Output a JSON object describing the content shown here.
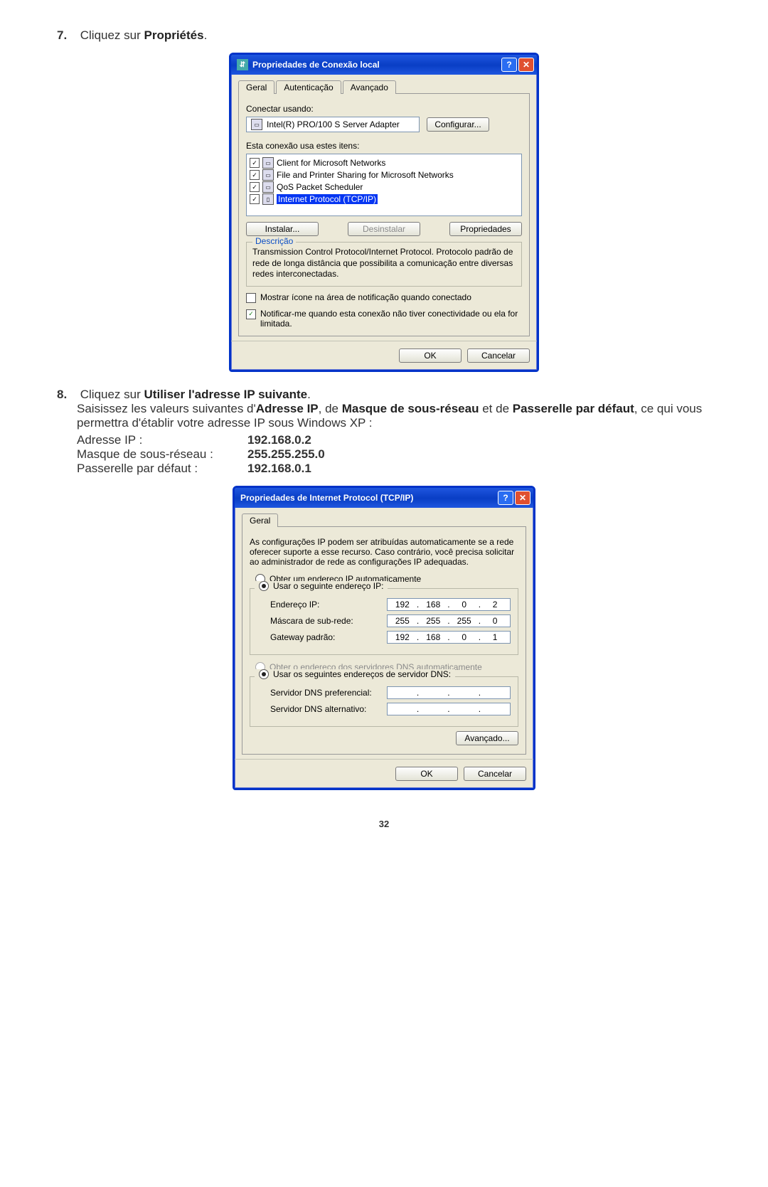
{
  "step7": {
    "num": "7.",
    "pre": "Cliquez sur ",
    "bold": "Propriétés",
    "post": "."
  },
  "win1": {
    "title": "Propriedades de Conexão local",
    "tabs": {
      "geral": "Geral",
      "aut": "Autenticação",
      "av": "Avançado"
    },
    "connect_label": "Conectar usando:",
    "adapter": "Intel(R) PRO/100 S Server Adapter",
    "configurar_btn": "Configurar...",
    "items_label": "Esta conexão usa estes itens:",
    "items": [
      "Client for Microsoft Networks",
      "File and Printer Sharing for Microsoft Networks",
      "QoS Packet Scheduler",
      "Internet Protocol (TCP/IP)"
    ],
    "instalar_btn": "Instalar...",
    "desinstalar_btn": "Desinstalar",
    "propriedades_btn": "Propriedades",
    "desc_legend": "Descrição",
    "desc_text": "Transmission Control Protocol/Internet Protocol. Protocolo padrão de rede de longa distância que possibilita a comunicação entre diversas redes interconectadas.",
    "chk1": "Mostrar ícone na área de notificação quando conectado",
    "chk2": "Notificar-me quando esta conexão não tiver conectividade ou ela for limitada.",
    "ok": "OK",
    "cancel": "Cancelar"
  },
  "step8": {
    "num": "8.",
    "line1_pre": "Cliquez sur ",
    "line1_bold": "Utiliser l'adresse IP suivante",
    "line1_post": ".",
    "line2_a": "Saisissez les valeurs suivantes d'",
    "line2_b": "Adresse IP",
    "line2_c": ", de ",
    "line2_d": "Masque de sous-réseau",
    "line2_e": " et de ",
    "line2_f": "Passerelle par défaut",
    "line2_g": ", ce qui vous permettra d'établir votre adresse IP sous Windows XP :",
    "kv": {
      "ip_label": "Adresse IP :",
      "ip_val": "192.168.0.2",
      "mask_label": "Masque de sous-réseau :",
      "mask_val": "255.255.255.0",
      "gw_label": "Passerelle par défaut :",
      "gw_val": "192.168.0.1"
    }
  },
  "win2": {
    "title": "Propriedades de Internet Protocol (TCP/IP)",
    "tab": "Geral",
    "intro": "As configurações IP podem ser atribuídas automaticamente se a rede oferecer suporte a esse recurso. Caso contrário, você precisa solicitar ao administrador de rede as configurações IP adequadas.",
    "radio_auto_ip": "Obter um endereço IP automaticamente",
    "radio_use_ip": "Usar o seguinte endereço IP:",
    "lbl_endereco": "Endereço IP:",
    "lbl_mascara": "Máscara de sub-rede:",
    "lbl_gateway": "Gateway padrão:",
    "ip": {
      "a": "192",
      "b": "168",
      "c": "0",
      "d": "2"
    },
    "mask": {
      "a": "255",
      "b": "255",
      "c": "255",
      "d": "0"
    },
    "gw": {
      "a": "192",
      "b": "168",
      "c": "0",
      "d": "1"
    },
    "radio_auto_dns": "Obter o endereço dos servidores DNS automaticamente",
    "radio_use_dns": "Usar os seguintes endereços de servidor DNS:",
    "lbl_dns_pref": "Servidor DNS preferencial:",
    "lbl_dns_alt": "Servidor DNS alternativo:",
    "avancado": "Avançado...",
    "ok": "OK",
    "cancel": "Cancelar"
  },
  "page_num": "32"
}
